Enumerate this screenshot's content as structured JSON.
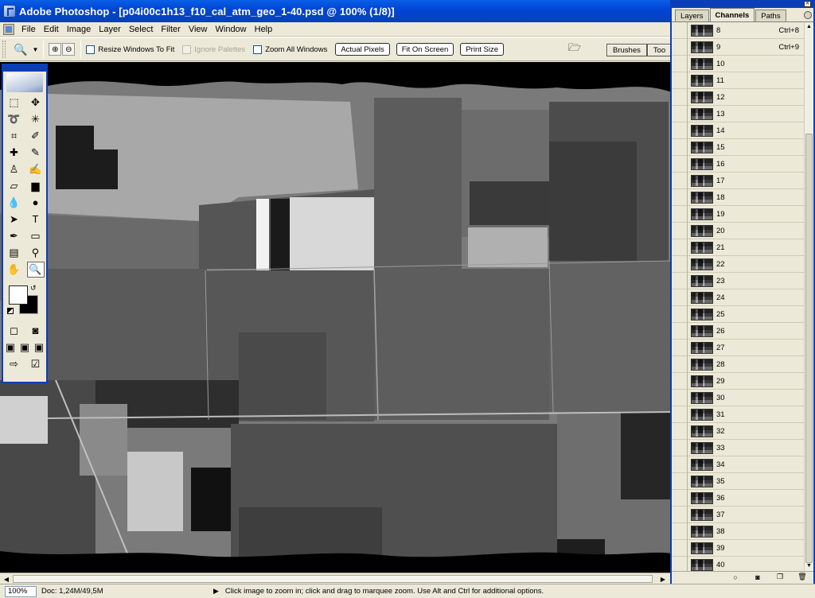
{
  "window": {
    "title": "Adobe Photoshop - [p04i00c1h13_f10_cal_atm_geo_1-40.psd @ 100% (1/8)]"
  },
  "menu": [
    "File",
    "Edit",
    "Image",
    "Layer",
    "Select",
    "Filter",
    "View",
    "Window",
    "Help"
  ],
  "options": {
    "resize_windows": "Resize Windows To Fit",
    "ignore_palettes": "Ignore Palettes",
    "zoom_all": "Zoom All Windows",
    "actual_pixels": "Actual Pixels",
    "fit_on_screen": "Fit On Screen",
    "print_size": "Print Size",
    "well_tabs": [
      "Brushes",
      "Too"
    ]
  },
  "toolbox": {
    "rows": [
      [
        {
          "name": "marquee-tool-icon",
          "glyph": "⬚"
        },
        {
          "name": "move-tool-icon",
          "glyph": "✥"
        }
      ],
      [
        {
          "name": "lasso-tool-icon",
          "glyph": "➰"
        },
        {
          "name": "magic-wand-tool-icon",
          "glyph": "✳"
        }
      ],
      [
        {
          "name": "crop-tool-icon",
          "glyph": "⌗"
        },
        {
          "name": "slice-tool-icon",
          "glyph": "✐"
        }
      ],
      [
        {
          "name": "healing-brush-tool-icon",
          "glyph": "✚"
        },
        {
          "name": "brush-tool-icon",
          "glyph": "✎"
        }
      ],
      [
        {
          "name": "clone-stamp-tool-icon",
          "glyph": "♙"
        },
        {
          "name": "history-brush-tool-icon",
          "glyph": "✍"
        }
      ],
      [
        {
          "name": "eraser-tool-icon",
          "glyph": "▱"
        },
        {
          "name": "gradient-tool-icon",
          "glyph": "▆"
        }
      ],
      [
        {
          "name": "blur-tool-icon",
          "glyph": "💧"
        },
        {
          "name": "dodge-tool-icon",
          "glyph": "●"
        }
      ],
      [
        {
          "name": "path-selection-tool-icon",
          "glyph": "➤"
        },
        {
          "name": "type-tool-icon",
          "glyph": "T"
        }
      ],
      [
        {
          "name": "pen-tool-icon",
          "glyph": "✒"
        },
        {
          "name": "shape-tool-icon",
          "glyph": "▭"
        }
      ],
      [
        {
          "name": "notes-tool-icon",
          "glyph": "▤"
        },
        {
          "name": "eyedropper-tool-icon",
          "glyph": "⚲"
        }
      ],
      [
        {
          "name": "hand-tool-icon",
          "glyph": "✋"
        },
        {
          "name": "zoom-tool-icon",
          "glyph": "🔍"
        }
      ]
    ],
    "modes": [
      [
        {
          "name": "standard-mode-icon",
          "glyph": "◻"
        },
        {
          "name": "quick-mask-mode-icon",
          "glyph": "◙"
        }
      ],
      [
        {
          "name": "screen-mode-standard-icon",
          "glyph": "▣"
        },
        {
          "name": "screen-mode-full-menu-icon",
          "glyph": "▣"
        },
        {
          "name": "screen-mode-full-icon",
          "glyph": "▣"
        }
      ],
      [
        {
          "name": "jump-to-imageready-icon",
          "glyph": "⇨"
        },
        {
          "name": "edit-in-imageready-icon",
          "glyph": "☑"
        }
      ]
    ]
  },
  "status": {
    "zoom": "100%",
    "doc": "Doc: 1,24M/49,5M",
    "message": "Click image to zoom in; click and drag to marquee zoom.  Use Alt and Ctrl for additional options."
  },
  "channels_panel": {
    "tabs": [
      "Layers",
      "Channels",
      "Paths"
    ],
    "active_tab": "Channels",
    "channels": [
      {
        "name": "8",
        "shortcut": "Ctrl+8"
      },
      {
        "name": "9",
        "shortcut": "Ctrl+9"
      },
      {
        "name": "10",
        "shortcut": ""
      },
      {
        "name": "11",
        "shortcut": ""
      },
      {
        "name": "12",
        "shortcut": ""
      },
      {
        "name": "13",
        "shortcut": ""
      },
      {
        "name": "14",
        "shortcut": ""
      },
      {
        "name": "15",
        "shortcut": ""
      },
      {
        "name": "16",
        "shortcut": ""
      },
      {
        "name": "17",
        "shortcut": ""
      },
      {
        "name": "18",
        "shortcut": ""
      },
      {
        "name": "19",
        "shortcut": ""
      },
      {
        "name": "20",
        "shortcut": ""
      },
      {
        "name": "21",
        "shortcut": ""
      },
      {
        "name": "22",
        "shortcut": ""
      },
      {
        "name": "23",
        "shortcut": ""
      },
      {
        "name": "24",
        "shortcut": ""
      },
      {
        "name": "25",
        "shortcut": ""
      },
      {
        "name": "26",
        "shortcut": ""
      },
      {
        "name": "27",
        "shortcut": ""
      },
      {
        "name": "28",
        "shortcut": ""
      },
      {
        "name": "29",
        "shortcut": ""
      },
      {
        "name": "30",
        "shortcut": ""
      },
      {
        "name": "31",
        "shortcut": ""
      },
      {
        "name": "32",
        "shortcut": ""
      },
      {
        "name": "33",
        "shortcut": ""
      },
      {
        "name": "34",
        "shortcut": ""
      },
      {
        "name": "35",
        "shortcut": ""
      },
      {
        "name": "36",
        "shortcut": ""
      },
      {
        "name": "37",
        "shortcut": ""
      },
      {
        "name": "38",
        "shortcut": ""
      },
      {
        "name": "39",
        "shortcut": ""
      },
      {
        "name": "40",
        "shortcut": ""
      }
    ]
  },
  "colors": {
    "title_blue": "#0b3fb8",
    "chrome": "#ece9d8"
  }
}
